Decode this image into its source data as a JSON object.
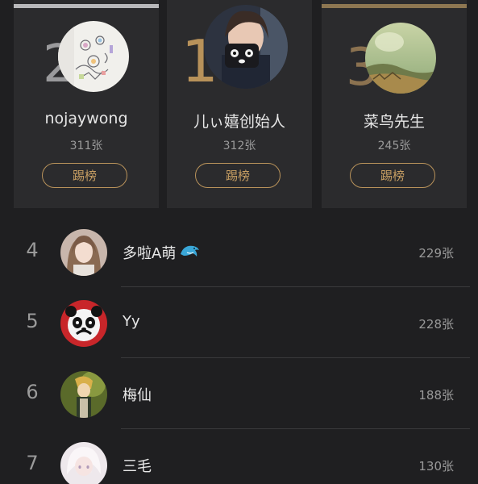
{
  "podium": {
    "first": {
      "rank": "1",
      "name": "儿ぃ嬉创始人",
      "count": "312张",
      "button": "踢榜",
      "avatar": "girl-with-mug-avatar"
    },
    "second": {
      "rank": "2",
      "name": "nojaywong",
      "count": "311张",
      "button": "踢榜",
      "avatar": "doodle-art-avatar"
    },
    "third": {
      "rank": "3",
      "name": "菜鸟先生",
      "count": "245张",
      "button": "踢榜",
      "avatar": "landscape-avatar"
    }
  },
  "list": [
    {
      "rank": "4",
      "name": "多啦A萌",
      "count": "229张",
      "avatar": "girl-avatar",
      "emoji": "dolphin-icon"
    },
    {
      "rank": "5",
      "name": "Yy",
      "count": "228张",
      "avatar": "panda-face-avatar"
    },
    {
      "rank": "6",
      "name": "梅仙",
      "count": "188张",
      "avatar": "anime-character-avatar"
    },
    {
      "rank": "7",
      "name": "三毛",
      "count": "130张",
      "avatar": "white-hair-anime-avatar"
    }
  ],
  "colors": {
    "background": "#1f1f21",
    "card": "#2b2b2d",
    "gold": "#b8925a",
    "silver": "#b9b9bb",
    "bronze": "#8e7752"
  }
}
